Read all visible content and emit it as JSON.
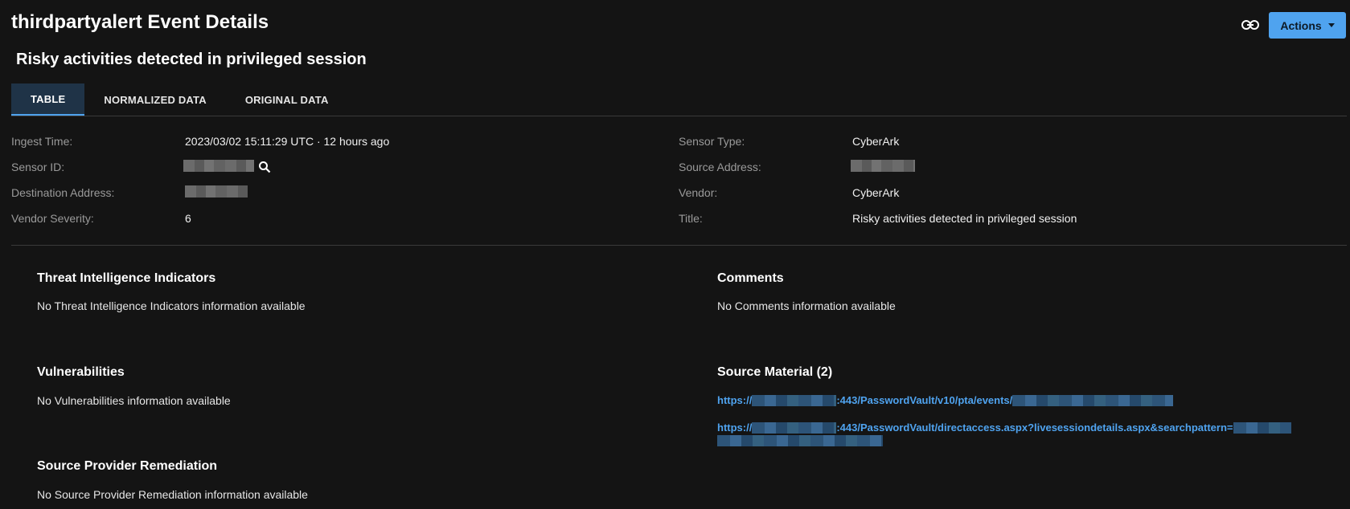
{
  "header": {
    "title": "thirdpartyalert Event Details",
    "subtitle": "Risky activities detected in privileged session",
    "actions_label": "Actions",
    "link_icon": "link-icon"
  },
  "tabs": [
    {
      "label": "TABLE",
      "active": true
    },
    {
      "label": "NORMALIZED DATA",
      "active": false
    },
    {
      "label": "ORIGINAL DATA",
      "active": false
    }
  ],
  "fields": {
    "ingest_time": {
      "label": "Ingest Time:",
      "value": "2023/03/02 15:11:29 UTC · 12 hours ago"
    },
    "sensor_id": {
      "label": "Sensor ID:",
      "value": ""
    },
    "destination_address": {
      "label": "Destination Address:",
      "value": ""
    },
    "vendor_severity": {
      "label": "Vendor Severity:",
      "value": "6"
    },
    "sensor_type": {
      "label": "Sensor Type:",
      "value": "CyberArk"
    },
    "source_address": {
      "label": "Source Address:",
      "value": ""
    },
    "vendor": {
      "label": "Vendor:",
      "value": "CyberArk"
    },
    "title": {
      "label": "Title:",
      "value": "Risky activities detected in privileged session"
    }
  },
  "sections": {
    "threat_intel": {
      "title": "Threat Intelligence Indicators",
      "empty": "No Threat Intelligence Indicators information available"
    },
    "comments": {
      "title": "Comments",
      "empty": "No Comments information available"
    },
    "vulnerabilities": {
      "title": "Vulnerabilities",
      "empty": "No Vulnerabilities information available"
    },
    "source_material": {
      "title": "Source Material (2)",
      "links": [
        {
          "prefix": "https://",
          "middle": ":443/PasswordVault/v10/pta/events/"
        },
        {
          "prefix": "https://",
          "middle": ":443/PasswordVault/directaccess.aspx?livesessiondetails.aspx&searchpattern="
        }
      ]
    },
    "remediation": {
      "title": "Source Provider Remediation",
      "empty": "No Source Provider Remediation information available"
    }
  },
  "colors": {
    "accent": "#4fa3ef",
    "background": "#141414",
    "active_tab": "#1f3347"
  }
}
